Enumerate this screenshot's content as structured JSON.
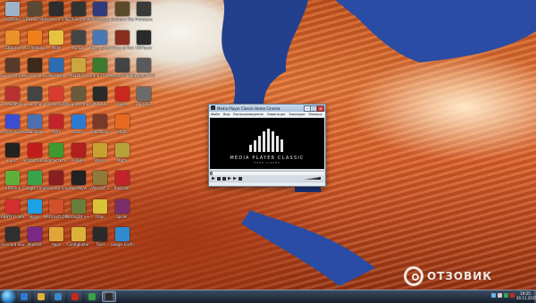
{
  "desktop_icons": [
    {
      "label": "Корзина",
      "color": "#9fb3c8"
    },
    {
      "label": "CDBurner",
      "color": "#e8902a"
    },
    {
      "label": "Sound Of Ground",
      "color": "#5a3a2a"
    },
    {
      "label": "TimeShift Demo",
      "color": "#b8322f"
    },
    {
      "label": "Асуито ВЭ Нaбор",
      "color": "#3b4ed0"
    },
    {
      "label": "Крест",
      "color": "#222222"
    },
    {
      "label": "uTorrent",
      "color": "#5fae3a"
    },
    {
      "label": "ABBYY FineReader",
      "color": "#d42f2f"
    },
    {
      "label": "Overlord Soundtrack",
      "color": "#2f2f2f"
    },
    {
      "label": "STALKER Shadow of",
      "color": "#5a4a35"
    },
    {
      "label": "VLC media player",
      "color": "#ef7f1a"
    },
    {
      "label": "Assassin 2 Ярлык",
      "color": "#3c2a1d"
    },
    {
      "label": "Launcher",
      "color": "#444444"
    },
    {
      "label": "Downloads",
      "color": "#4d6fb0"
    },
    {
      "label": "Acrobat Reader DC",
      "color": "#c21d1d"
    },
    {
      "label": "Google Chrome",
      "color": "#3aa24b"
    },
    {
      "label": "Skype",
      "color": "#1ea1e3"
    },
    {
      "label": "WinRAR",
      "color": "#7a2a86"
    },
    {
      "label": "Assassin 3 Ярлык",
      "color": "#2d2d2d"
    },
    {
      "label": "Inline",
      "color": "#e6c240"
    },
    {
      "label": "Эмулятор",
      "color": "#2c6cb3"
    },
    {
      "label": "Alcohol 120%",
      "color": "#d83b2f"
    },
    {
      "label": "Avira",
      "color": "#c2232a"
    },
    {
      "label": "Запустить",
      "color": "#3f9a2e"
    },
    {
      "label": "Assassin Creed",
      "color": "#8a1f1f"
    },
    {
      "label": "Microsoft Office",
      "color": "#d2512b"
    },
    {
      "label": "Apps",
      "color": "#e1a43a"
    },
    {
      "label": "GTA San Andreas",
      "color": "#333333"
    },
    {
      "label": "Ярлык",
      "color": "#444444"
    },
    {
      "label": "FALLOUT 3",
      "color": "#c9a640"
    },
    {
      "label": "Counterstrike",
      "color": "#6b5a3b"
    },
    {
      "label": "Picasa",
      "color": "#2f7ad1"
    },
    {
      "label": "AI Ruler",
      "color": "#b11f1f"
    },
    {
      "label": "MacPlayer",
      "color": "#222222"
    },
    {
      "label": "StrongDC++",
      "color": "#6a7e3b"
    },
    {
      "label": "ConfigEditor",
      "color": "#dcb13a"
    },
    {
      "label": "Photoshop",
      "color": "#2f3b7a"
    },
    {
      "label": "Компьютер",
      "color": "#4a78b6"
    },
    {
      "label": "Grand Theft Auto",
      "color": "#3b7a2f"
    },
    {
      "label": "MPC-HC",
      "color": "#2b2b2b"
    },
    {
      "label": "Soulcalibur",
      "color": "#7a3a2a"
    },
    {
      "label": "Steam",
      "color": "#c7a12f"
    },
    {
      "label": "FALLOUT 2",
      "color": "#8f7a3a"
    },
    {
      "label": "Fraps",
      "color": "#d8c237"
    },
    {
      "label": "Thief",
      "color": "#2b2b2b"
    },
    {
      "label": "Dungeon Siege",
      "color": "#5a4a2a"
    },
    {
      "label": "Prince of Persia",
      "color": "#8a2f1f"
    },
    {
      "label": "Assassin Revelations",
      "color": "#444444"
    },
    {
      "label": "Opera",
      "color": "#c9281f"
    },
    {
      "label": "Origin",
      "color": "#e66a1f"
    },
    {
      "label": "Mafia",
      "color": "#b8a03a"
    },
    {
      "label": "Rockstar",
      "color": "#c2232a"
    },
    {
      "label": "Spider",
      "color": "#7a2f6b"
    },
    {
      "label": "Google Earth",
      "color": "#2f8ad1"
    },
    {
      "label": "Prototype",
      "color": "#3a3a3a"
    },
    {
      "label": "KMPlayer",
      "color": "#2b2b2b"
    },
    {
      "label": "Resident Evil",
      "color": "#5a5a5a"
    },
    {
      "label": "DSC0037",
      "color": "#6b6b6b"
    }
  ],
  "mpc": {
    "title": "Media Player Classic Home Cinema",
    "menu": [
      "Файл",
      "Вид",
      "Воспроизведение",
      "Навигация",
      "Закладки",
      "Помощь"
    ],
    "logo_title": "MEDIA PLAYER CLASSIC",
    "logo_subtitle": "HOME CINEMA"
  },
  "watermark": {
    "text": "ОТЗОВИК"
  },
  "taskbar": {
    "buttons": [
      {
        "name": "ie",
        "color": "#2f7ad1",
        "active": false
      },
      {
        "name": "explorer",
        "color": "#e1b13a",
        "active": false
      },
      {
        "name": "media",
        "color": "#3a8ac9",
        "active": false
      },
      {
        "name": "opera",
        "color": "#c9281f",
        "active": false
      },
      {
        "name": "chrome",
        "color": "#3aa24b",
        "active": false
      },
      {
        "name": "mpc",
        "color": "#2b2b2b",
        "active": true
      }
    ],
    "time": "19:25",
    "date": "20.11.2015"
  }
}
